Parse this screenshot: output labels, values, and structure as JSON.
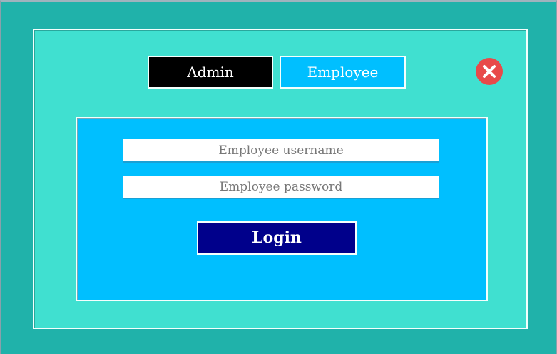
{
  "tabs": {
    "admin_label": "Admin",
    "employee_label": "Employee",
    "active": "Employee"
  },
  "form": {
    "username_placeholder": "Employee username",
    "username_value": "",
    "password_placeholder": "Employee password",
    "password_value": "",
    "login_label": "Login"
  },
  "icons": {
    "close": "close-icon"
  },
  "colors": {
    "window_bg": "#20b2aa",
    "panel_bg": "#40e0d0",
    "form_bg": "#00bfff",
    "admin_tab": "#000000",
    "employee_tab": "#00bfff",
    "login_button": "#00008b",
    "close_button": "#e84a4a"
  }
}
